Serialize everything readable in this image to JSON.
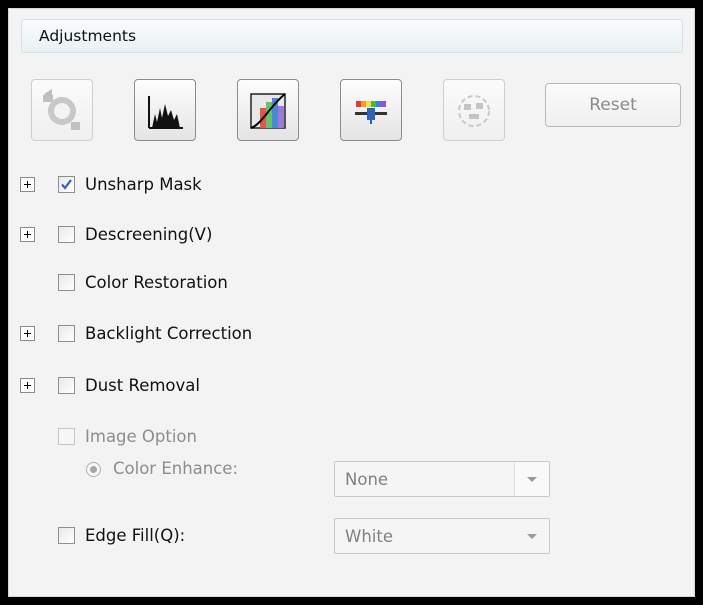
{
  "panel": {
    "title": "Adjustments"
  },
  "toolbar": {
    "buttons": [
      {
        "name": "auto-exposure",
        "icon": "auto-exposure-icon",
        "enabled": false
      },
      {
        "name": "histogram-adjustment",
        "icon": "histogram-icon",
        "enabled": true
      },
      {
        "name": "tone-correction",
        "icon": "tone-curve-icon",
        "enabled": true
      },
      {
        "name": "image-adjustment",
        "icon": "color-palette-slider-icon",
        "enabled": true
      },
      {
        "name": "color-palette",
        "icon": "color-palette-icon",
        "enabled": false
      }
    ],
    "reset_label": "Reset"
  },
  "options": {
    "unsharp_mask": {
      "label": "Unsharp Mask",
      "checked": true
    },
    "descreening": {
      "label": "Descreening(V)",
      "checked": false
    },
    "color_restoration": {
      "label": "Color Restoration",
      "checked": false
    },
    "backlight_correction": {
      "label": "Backlight Correction",
      "checked": false
    },
    "dust_removal": {
      "label": "Dust Removal",
      "checked": false
    },
    "image_option": {
      "label": "Image Option",
      "checked": false,
      "enabled": false
    },
    "color_enhance": {
      "label": "Color Enhance:",
      "value": "None"
    },
    "edge_fill": {
      "label": "Edge Fill(Q):",
      "checked": false,
      "value": "White"
    }
  }
}
